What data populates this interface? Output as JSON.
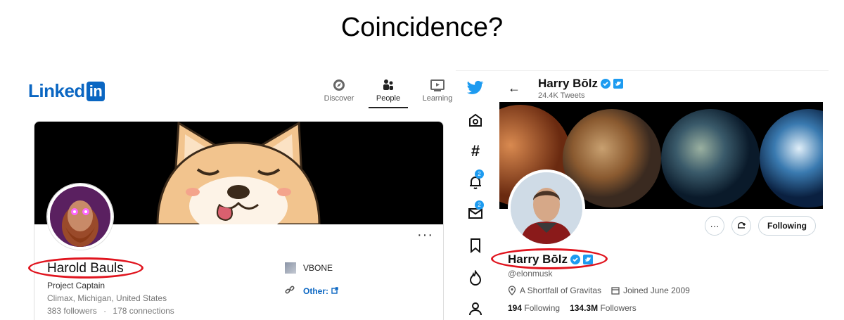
{
  "slide": {
    "title": "Coincidence?"
  },
  "linkedin": {
    "logo_text": "Linked",
    "logo_in": "in",
    "nav": [
      {
        "label": "Discover",
        "icon": "compass-icon",
        "active": false
      },
      {
        "label": "People",
        "icon": "people-icon",
        "active": true
      },
      {
        "label": "Learning",
        "icon": "video-icon",
        "active": false
      }
    ],
    "profile": {
      "name": "Harold Bauls",
      "headline": "Project Captain",
      "location": "Climax, Michigan, United States",
      "followers": "383 followers",
      "separator": "·",
      "connections": "178 connections",
      "company": "VBONE",
      "other_link": "Other:",
      "more": "···"
    }
  },
  "twitter": {
    "header": {
      "name": "Harry Bōlz",
      "tweet_count": "24.4K Tweets"
    },
    "sidebar_badges": {
      "notifications": "2",
      "messages": "2"
    },
    "profile": {
      "name": "Harry Bōlz",
      "handle": "@elonmusk",
      "location": "A Shortfall of Gravitas",
      "joined": "Joined June 2009",
      "following_count": "194",
      "following_label": "Following",
      "followers_count": "134.3M",
      "followers_label": "Followers",
      "follow_button": "Following",
      "more": "···"
    }
  },
  "colors": {
    "linkedin_blue": "#0a66c2",
    "twitter_blue": "#1d9bf0",
    "annotation_red": "#e0141e"
  }
}
